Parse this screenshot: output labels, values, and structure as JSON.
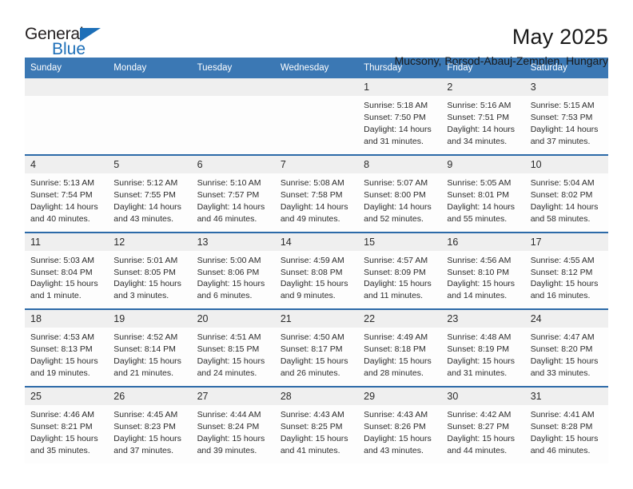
{
  "brand": {
    "name_part1": "General",
    "name_part2": "Blue",
    "accent_color": "#1d6fb8"
  },
  "header": {
    "title": "May 2025",
    "subtitle": "Mucsony, Borsod-Abauj-Zemplen, Hungary",
    "header_bar_color": "#3b78b4",
    "daynum_band_color": "#efefef"
  },
  "weekdays": [
    "Sunday",
    "Monday",
    "Tuesday",
    "Wednesday",
    "Thursday",
    "Friday",
    "Saturday"
  ],
  "weeks": [
    [
      {
        "day": "",
        "lines": []
      },
      {
        "day": "",
        "lines": []
      },
      {
        "day": "",
        "lines": []
      },
      {
        "day": "",
        "lines": []
      },
      {
        "day": "1",
        "lines": [
          "Sunrise: 5:18 AM",
          "Sunset: 7:50 PM",
          "Daylight: 14 hours",
          "and 31 minutes."
        ]
      },
      {
        "day": "2",
        "lines": [
          "Sunrise: 5:16 AM",
          "Sunset: 7:51 PM",
          "Daylight: 14 hours",
          "and 34 minutes."
        ]
      },
      {
        "day": "3",
        "lines": [
          "Sunrise: 5:15 AM",
          "Sunset: 7:53 PM",
          "Daylight: 14 hours",
          "and 37 minutes."
        ]
      }
    ],
    [
      {
        "day": "4",
        "lines": [
          "Sunrise: 5:13 AM",
          "Sunset: 7:54 PM",
          "Daylight: 14 hours",
          "and 40 minutes."
        ]
      },
      {
        "day": "5",
        "lines": [
          "Sunrise: 5:12 AM",
          "Sunset: 7:55 PM",
          "Daylight: 14 hours",
          "and 43 minutes."
        ]
      },
      {
        "day": "6",
        "lines": [
          "Sunrise: 5:10 AM",
          "Sunset: 7:57 PM",
          "Daylight: 14 hours",
          "and 46 minutes."
        ]
      },
      {
        "day": "7",
        "lines": [
          "Sunrise: 5:08 AM",
          "Sunset: 7:58 PM",
          "Daylight: 14 hours",
          "and 49 minutes."
        ]
      },
      {
        "day": "8",
        "lines": [
          "Sunrise: 5:07 AM",
          "Sunset: 8:00 PM",
          "Daylight: 14 hours",
          "and 52 minutes."
        ]
      },
      {
        "day": "9",
        "lines": [
          "Sunrise: 5:05 AM",
          "Sunset: 8:01 PM",
          "Daylight: 14 hours",
          "and 55 minutes."
        ]
      },
      {
        "day": "10",
        "lines": [
          "Sunrise: 5:04 AM",
          "Sunset: 8:02 PM",
          "Daylight: 14 hours",
          "and 58 minutes."
        ]
      }
    ],
    [
      {
        "day": "11",
        "lines": [
          "Sunrise: 5:03 AM",
          "Sunset: 8:04 PM",
          "Daylight: 15 hours",
          "and 1 minute."
        ]
      },
      {
        "day": "12",
        "lines": [
          "Sunrise: 5:01 AM",
          "Sunset: 8:05 PM",
          "Daylight: 15 hours",
          "and 3 minutes."
        ]
      },
      {
        "day": "13",
        "lines": [
          "Sunrise: 5:00 AM",
          "Sunset: 8:06 PM",
          "Daylight: 15 hours",
          "and 6 minutes."
        ]
      },
      {
        "day": "14",
        "lines": [
          "Sunrise: 4:59 AM",
          "Sunset: 8:08 PM",
          "Daylight: 15 hours",
          "and 9 minutes."
        ]
      },
      {
        "day": "15",
        "lines": [
          "Sunrise: 4:57 AM",
          "Sunset: 8:09 PM",
          "Daylight: 15 hours",
          "and 11 minutes."
        ]
      },
      {
        "day": "16",
        "lines": [
          "Sunrise: 4:56 AM",
          "Sunset: 8:10 PM",
          "Daylight: 15 hours",
          "and 14 minutes."
        ]
      },
      {
        "day": "17",
        "lines": [
          "Sunrise: 4:55 AM",
          "Sunset: 8:12 PM",
          "Daylight: 15 hours",
          "and 16 minutes."
        ]
      }
    ],
    [
      {
        "day": "18",
        "lines": [
          "Sunrise: 4:53 AM",
          "Sunset: 8:13 PM",
          "Daylight: 15 hours",
          "and 19 minutes."
        ]
      },
      {
        "day": "19",
        "lines": [
          "Sunrise: 4:52 AM",
          "Sunset: 8:14 PM",
          "Daylight: 15 hours",
          "and 21 minutes."
        ]
      },
      {
        "day": "20",
        "lines": [
          "Sunrise: 4:51 AM",
          "Sunset: 8:15 PM",
          "Daylight: 15 hours",
          "and 24 minutes."
        ]
      },
      {
        "day": "21",
        "lines": [
          "Sunrise: 4:50 AM",
          "Sunset: 8:17 PM",
          "Daylight: 15 hours",
          "and 26 minutes."
        ]
      },
      {
        "day": "22",
        "lines": [
          "Sunrise: 4:49 AM",
          "Sunset: 8:18 PM",
          "Daylight: 15 hours",
          "and 28 minutes."
        ]
      },
      {
        "day": "23",
        "lines": [
          "Sunrise: 4:48 AM",
          "Sunset: 8:19 PM",
          "Daylight: 15 hours",
          "and 31 minutes."
        ]
      },
      {
        "day": "24",
        "lines": [
          "Sunrise: 4:47 AM",
          "Sunset: 8:20 PM",
          "Daylight: 15 hours",
          "and 33 minutes."
        ]
      }
    ],
    [
      {
        "day": "25",
        "lines": [
          "Sunrise: 4:46 AM",
          "Sunset: 8:21 PM",
          "Daylight: 15 hours",
          "and 35 minutes."
        ]
      },
      {
        "day": "26",
        "lines": [
          "Sunrise: 4:45 AM",
          "Sunset: 8:23 PM",
          "Daylight: 15 hours",
          "and 37 minutes."
        ]
      },
      {
        "day": "27",
        "lines": [
          "Sunrise: 4:44 AM",
          "Sunset: 8:24 PM",
          "Daylight: 15 hours",
          "and 39 minutes."
        ]
      },
      {
        "day": "28",
        "lines": [
          "Sunrise: 4:43 AM",
          "Sunset: 8:25 PM",
          "Daylight: 15 hours",
          "and 41 minutes."
        ]
      },
      {
        "day": "29",
        "lines": [
          "Sunrise: 4:43 AM",
          "Sunset: 8:26 PM",
          "Daylight: 15 hours",
          "and 43 minutes."
        ]
      },
      {
        "day": "30",
        "lines": [
          "Sunrise: 4:42 AM",
          "Sunset: 8:27 PM",
          "Daylight: 15 hours",
          "and 44 minutes."
        ]
      },
      {
        "day": "31",
        "lines": [
          "Sunrise: 4:41 AM",
          "Sunset: 8:28 PM",
          "Daylight: 15 hours",
          "and 46 minutes."
        ]
      }
    ]
  ]
}
